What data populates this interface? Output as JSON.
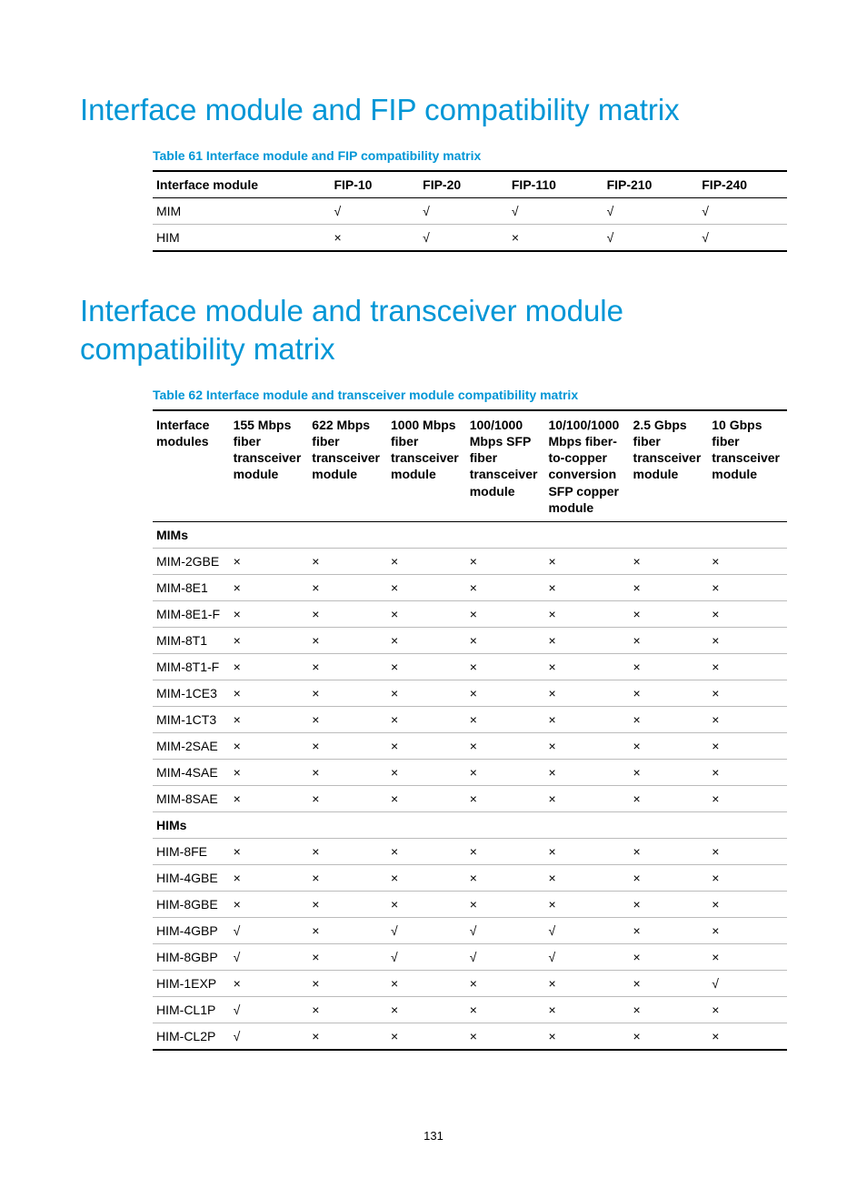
{
  "marks": {
    "yes": "√",
    "no": "×"
  },
  "page_number": "131",
  "sections": {
    "s1": {
      "title": "Interface module and FIP compatibility matrix",
      "caption": "Table 61 Interface module and FIP compatibility matrix",
      "columns": [
        "Interface module",
        "FIP-10",
        "FIP-20",
        "FIP-110",
        "FIP-210",
        "FIP-240"
      ],
      "rows": [
        {
          "label": "MIM",
          "cells": [
            "yes",
            "yes",
            "yes",
            "yes",
            "yes"
          ]
        },
        {
          "label": "HIM",
          "cells": [
            "no",
            "yes",
            "no",
            "yes",
            "yes"
          ]
        }
      ]
    },
    "s2": {
      "title": "Interface module and transceiver module compatibility matrix",
      "caption": "Table 62 Interface module and transceiver module compatibility matrix",
      "columns": [
        "Interface modules",
        "155 Mbps fiber transceiver module",
        "622 Mbps fiber transceiver module",
        "1000 Mbps fiber transceiver module",
        "100/1000 Mbps SFP fiber transceiver module",
        "10/100/1000 Mbps fiber-to-copper conversion SFP copper module",
        "2.5 Gbps fiber transceiver module",
        "10 Gbps fiber transceiver module"
      ],
      "groups": [
        {
          "label": "MIMs",
          "rows": [
            {
              "label": "MIM-2GBE",
              "cells": [
                "no",
                "no",
                "no",
                "no",
                "no",
                "no",
                "no"
              ]
            },
            {
              "label": "MIM-8E1",
              "cells": [
                "no",
                "no",
                "no",
                "no",
                "no",
                "no",
                "no"
              ]
            },
            {
              "label": "MIM-8E1-F",
              "cells": [
                "no",
                "no",
                "no",
                "no",
                "no",
                "no",
                "no"
              ]
            },
            {
              "label": "MIM-8T1",
              "cells": [
                "no",
                "no",
                "no",
                "no",
                "no",
                "no",
                "no"
              ]
            },
            {
              "label": "MIM-8T1-F",
              "cells": [
                "no",
                "no",
                "no",
                "no",
                "no",
                "no",
                "no"
              ]
            },
            {
              "label": "MIM-1CE3",
              "cells": [
                "no",
                "no",
                "no",
                "no",
                "no",
                "no",
                "no"
              ]
            },
            {
              "label": "MIM-1CT3",
              "cells": [
                "no",
                "no",
                "no",
                "no",
                "no",
                "no",
                "no"
              ]
            },
            {
              "label": "MIM-2SAE",
              "cells": [
                "no",
                "no",
                "no",
                "no",
                "no",
                "no",
                "no"
              ]
            },
            {
              "label": "MIM-4SAE",
              "cells": [
                "no",
                "no",
                "no",
                "no",
                "no",
                "no",
                "no"
              ]
            },
            {
              "label": "MIM-8SAE",
              "cells": [
                "no",
                "no",
                "no",
                "no",
                "no",
                "no",
                "no"
              ]
            }
          ]
        },
        {
          "label": "HIMs",
          "rows": [
            {
              "label": "HIM-8FE",
              "cells": [
                "no",
                "no",
                "no",
                "no",
                "no",
                "no",
                "no"
              ]
            },
            {
              "label": "HIM-4GBE",
              "cells": [
                "no",
                "no",
                "no",
                "no",
                "no",
                "no",
                "no"
              ]
            },
            {
              "label": "HIM-8GBE",
              "cells": [
                "no",
                "no",
                "no",
                "no",
                "no",
                "no",
                "no"
              ]
            },
            {
              "label": "HIM-4GBP",
              "cells": [
                "yes",
                "no",
                "yes",
                "yes",
                "yes",
                "no",
                "no"
              ]
            },
            {
              "label": "HIM-8GBP",
              "cells": [
                "yes",
                "no",
                "yes",
                "yes",
                "yes",
                "no",
                "no"
              ]
            },
            {
              "label": "HIM-1EXP",
              "cells": [
                "no",
                "no",
                "no",
                "no",
                "no",
                "no",
                "yes"
              ]
            },
            {
              "label": "HIM-CL1P",
              "cells": [
                "yes",
                "no",
                "no",
                "no",
                "no",
                "no",
                "no"
              ]
            },
            {
              "label": "HIM-CL2P",
              "cells": [
                "yes",
                "no",
                "no",
                "no",
                "no",
                "no",
                "no"
              ]
            }
          ]
        }
      ]
    }
  }
}
